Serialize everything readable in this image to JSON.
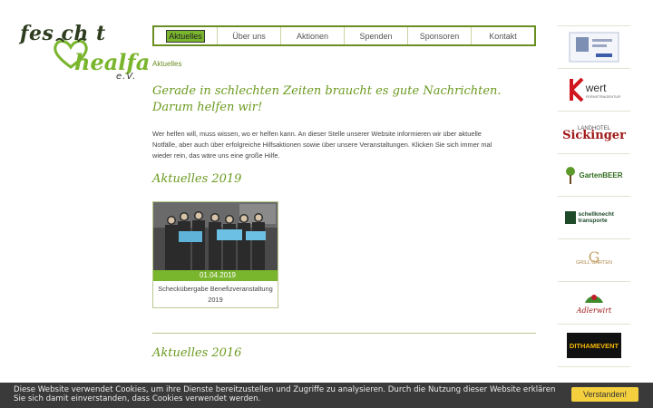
{
  "logo": {
    "line1": "fes  ch  t",
    "line2": "healfa",
    "line3": "e.V."
  },
  "nav": {
    "items": [
      "Aktuelles",
      "Über uns",
      "Aktionen",
      "Spenden",
      "Sponsoren",
      "Kontakt"
    ],
    "active": "Aktuelles"
  },
  "breadcrumb": "Aktuelles",
  "headline": {
    "line1": "Gerade in schlechten Zeiten braucht es gute Nachrichten.",
    "line2": "Darum helfen wir!"
  },
  "intro": "Wer helfen will, muss wissen, wo er helfen kann. An dieser Stelle unserer Website informieren wir über aktuelle Notfälle, aber auch über erfolgreiche Hilfsaktionen sowie über unsere Veranstaltungen. Klicken Sie sich immer mal wieder rein, das wäre uns eine große Hilfe.",
  "sections": [
    {
      "title": "Aktuelles 2019",
      "cards": [
        {
          "date": "01.04.2019",
          "caption": "Scheckübergabe Benefizveranstaltung 2019"
        }
      ]
    },
    {
      "title": "Aktuelles 2016"
    }
  ],
  "sponsors": [
    {
      "name": "sponsor-1",
      "text": ""
    },
    {
      "name": "kwert",
      "text": "wert",
      "subtext": "FERNSTRAGENTUR"
    },
    {
      "name": "landhotel-sickinger",
      "text": "LANDHOTEL",
      "subtext": "Sickinger"
    },
    {
      "name": "gartenbeer",
      "text": "GartenBEER"
    },
    {
      "name": "schellknecht",
      "text": "schellknecht transporte"
    },
    {
      "name": "grill-garten",
      "text": "GRILL GARTEN"
    },
    {
      "name": "sponsor-7",
      "text": "Adlerwirt"
    },
    {
      "name": "dithamevent",
      "text": "DITHAMEVENT"
    },
    {
      "name": "sponsor-9",
      "text": ""
    }
  ],
  "cookie": {
    "message": "Diese Website verwendet Cookies, um ihre Dienste bereitzustellen und Zugriffe zu analysieren. Durch die Nutzung dieser Website erklären Sie sich damit einverstanden, dass Cookies verwendet werden.",
    "button": "Verstanden!"
  },
  "colors": {
    "green": "#7ab52e",
    "dark_green": "#6b8e23",
    "cookie_bg": "#3a3a3a",
    "cookie_button": "#f4d03f"
  }
}
